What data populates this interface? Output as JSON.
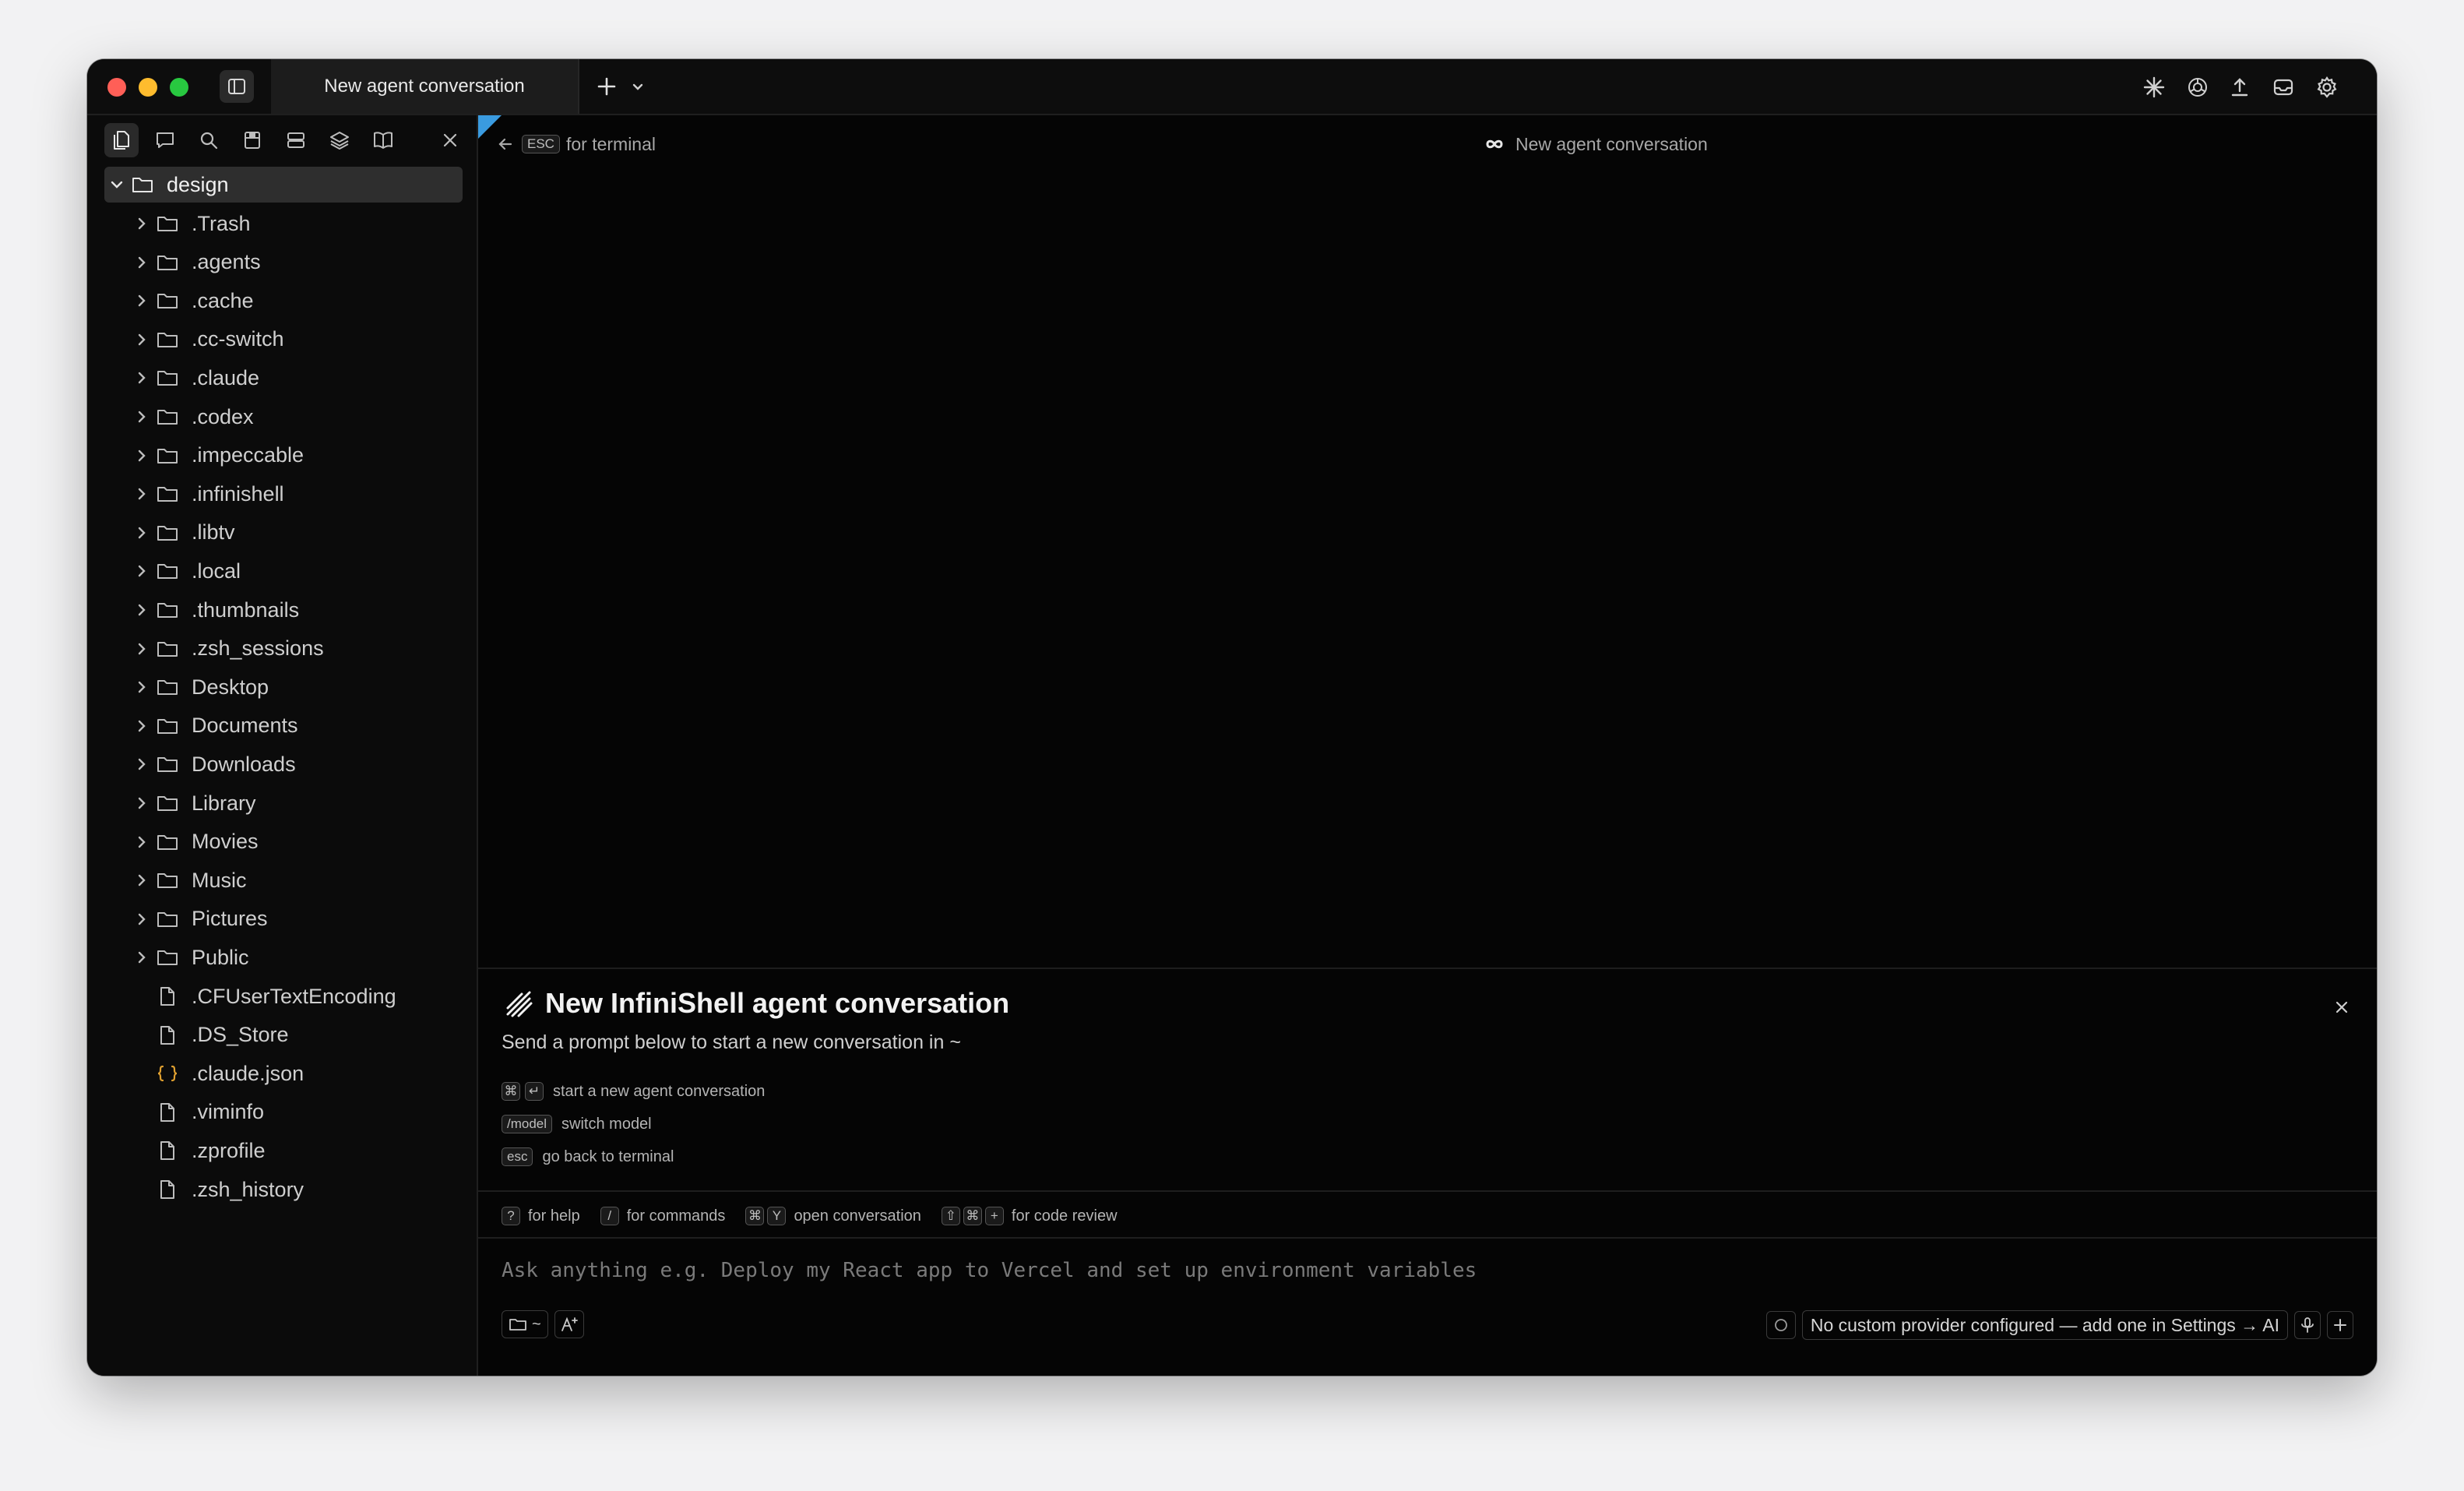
{
  "window": {
    "tab_title": "New agent conversation"
  },
  "sidebar": {
    "root": "design",
    "items": [
      {
        "name": ".Trash",
        "kind": "folder"
      },
      {
        "name": ".agents",
        "kind": "folder"
      },
      {
        "name": ".cache",
        "kind": "folder"
      },
      {
        "name": ".cc-switch",
        "kind": "folder"
      },
      {
        "name": ".claude",
        "kind": "folder"
      },
      {
        "name": ".codex",
        "kind": "folder"
      },
      {
        "name": ".impeccable",
        "kind": "folder"
      },
      {
        "name": ".infinishell",
        "kind": "folder"
      },
      {
        "name": ".libtv",
        "kind": "folder"
      },
      {
        "name": ".local",
        "kind": "folder"
      },
      {
        "name": ".thumbnails",
        "kind": "folder"
      },
      {
        "name": ".zsh_sessions",
        "kind": "folder"
      },
      {
        "name": "Desktop",
        "kind": "folder"
      },
      {
        "name": "Documents",
        "kind": "folder"
      },
      {
        "name": "Downloads",
        "kind": "folder"
      },
      {
        "name": "Library",
        "kind": "folder"
      },
      {
        "name": "Movies",
        "kind": "folder"
      },
      {
        "name": "Music",
        "kind": "folder"
      },
      {
        "name": "Pictures",
        "kind": "folder"
      },
      {
        "name": "Public",
        "kind": "folder"
      },
      {
        "name": ".CFUserTextEncoding",
        "kind": "file"
      },
      {
        "name": ".DS_Store",
        "kind": "file"
      },
      {
        "name": ".claude.json",
        "kind": "json"
      },
      {
        "name": ".viminfo",
        "kind": "file"
      },
      {
        "name": ".zprofile",
        "kind": "file"
      },
      {
        "name": ".zsh_history",
        "kind": "file"
      }
    ]
  },
  "main": {
    "back_key": "ESC",
    "back_label": "for terminal",
    "conversation_title": "New agent conversation",
    "welcome": {
      "title": "New InfiniShell agent conversation",
      "subtitle": "Send a prompt below to start a new conversation in ~",
      "hints": [
        {
          "keys": [
            "⌘",
            "↵"
          ],
          "label": "start a new agent conversation"
        },
        {
          "keys": [
            "/model"
          ],
          "label": "switch model"
        },
        {
          "keys": [
            "esc"
          ],
          "label": "go back to terminal"
        }
      ]
    },
    "shortcuts": [
      {
        "keys": [
          "?"
        ],
        "label": "for help"
      },
      {
        "keys": [
          "/"
        ],
        "label": "for commands"
      },
      {
        "keys": [
          "⌘",
          "Y"
        ],
        "label": "open conversation"
      },
      {
        "keys": [
          "⇧",
          "⌘",
          "+"
        ],
        "label": "for code review"
      }
    ],
    "prompt_placeholder": "Ask anything e.g. Deploy my React app to Vercel and set up environment variables",
    "dir_label": "~",
    "provider_status": "No custom provider configured — add one in Settings → AI"
  },
  "colors": {
    "accent_flag": "#3a9be0",
    "cursor": "#d36be0",
    "json_icon": "#e0a030"
  }
}
